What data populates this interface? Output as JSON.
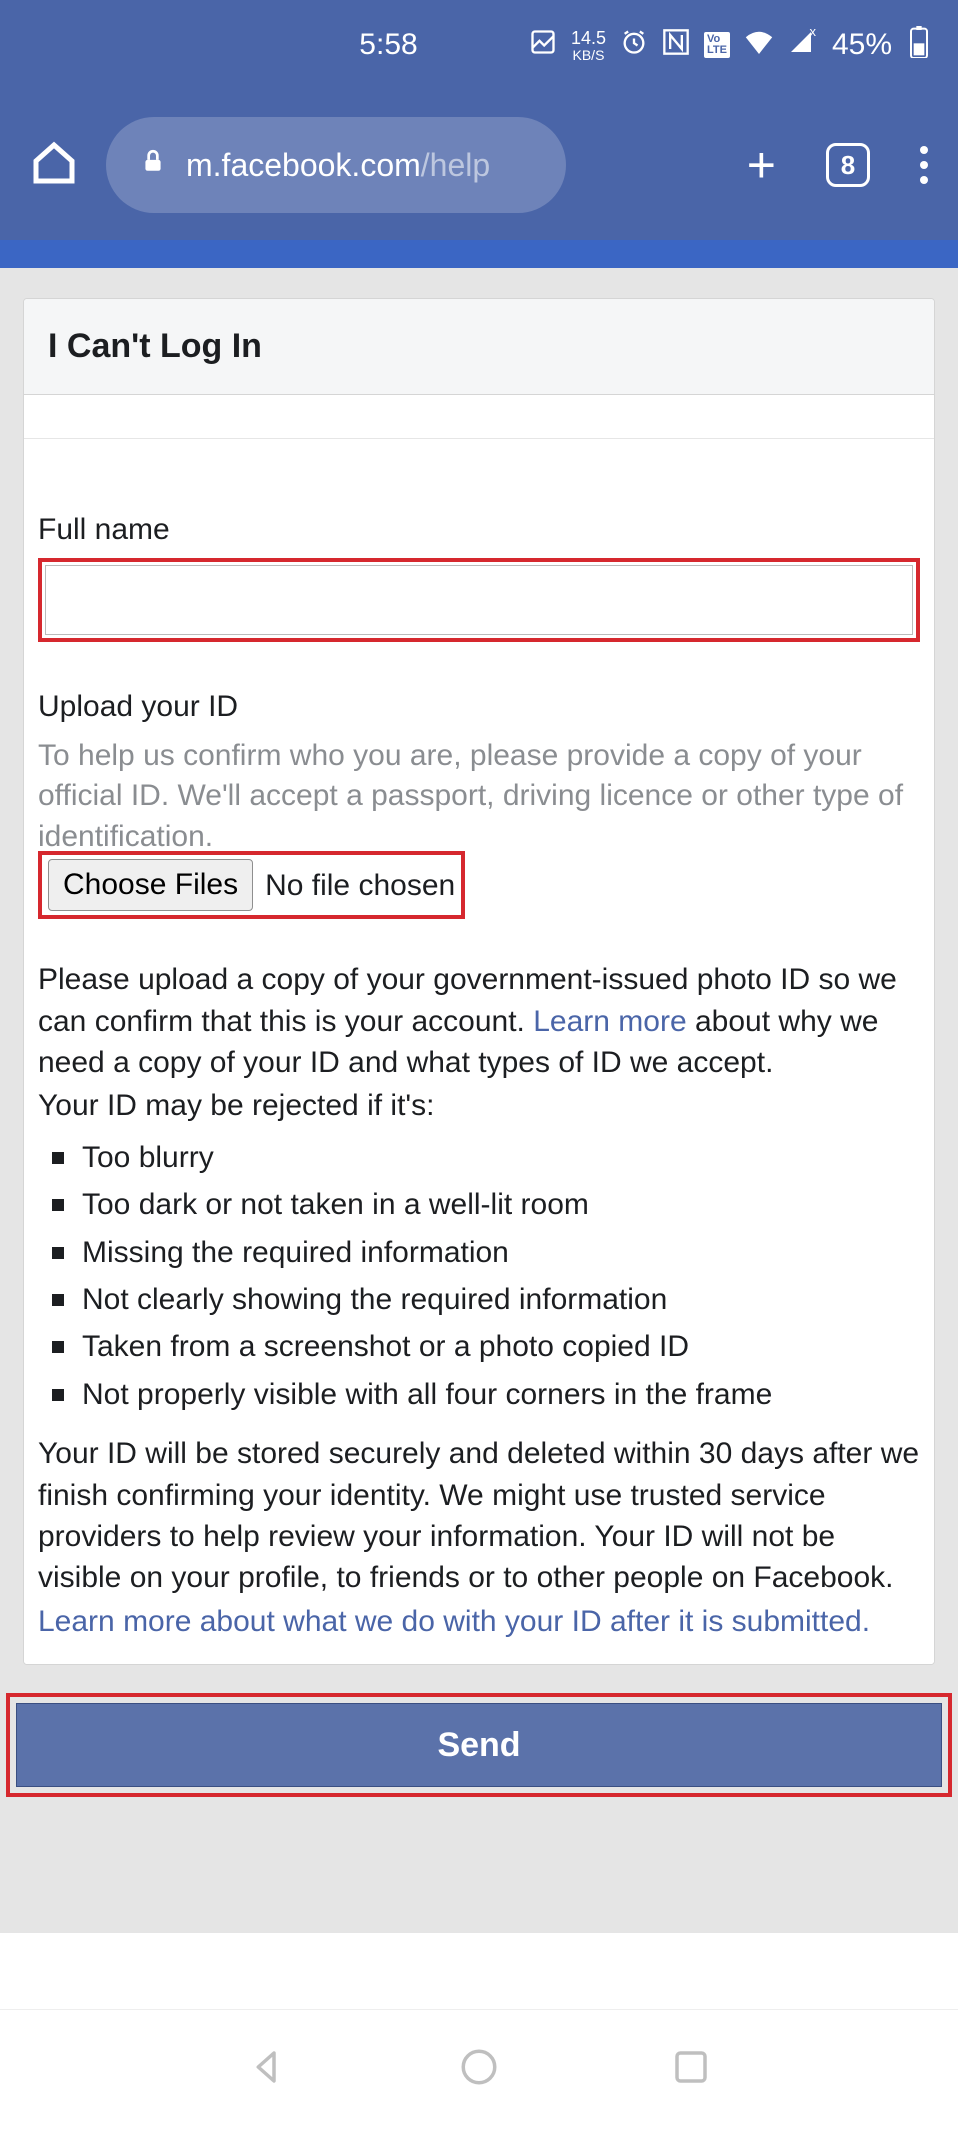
{
  "status": {
    "time": "5:58",
    "kbs_num": "14.5",
    "kbs_lbl": "KB/S",
    "battery_pct": "45%"
  },
  "browser": {
    "url_host": "m.facebook.com",
    "url_path": "/help",
    "tab_count": "8"
  },
  "page": {
    "title": "I Can't Log In",
    "full_name_label": "Full name",
    "full_name_value": "",
    "upload_label": "Upload your ID",
    "upload_desc": "To help us confirm who you are, please provide a copy of your official ID. We'll accept a passport, driving licence or other type of identification.",
    "choose_files_label": "Choose Files",
    "no_file_text": "No file chosen",
    "info_p1a": "Please upload a copy of your government-issued photo ID so we can confirm that this is your account. ",
    "learn_more_1": "Learn more",
    "info_p1b": " about why we need a copy of your ID and what types of ID we accept.",
    "reject_intro": "Your ID may be rejected if it's:",
    "rejects": [
      "Too blurry",
      "Too dark or not taken in a well-lit room",
      "Missing the required information",
      "Not clearly showing the required information",
      "Taken from a screenshot or a photo copied ID",
      "Not properly visible with all four corners in the frame"
    ],
    "storage": "Your ID will be stored securely and deleted within 30 days after we finish confirming your identity. We might use trusted service providers to help review your information. Your ID will not be visible on your profile, to friends or to other people on Facebook.",
    "learn_more_2": "Learn more about what we do with your ID after it is submitted.",
    "send_label": "Send"
  }
}
